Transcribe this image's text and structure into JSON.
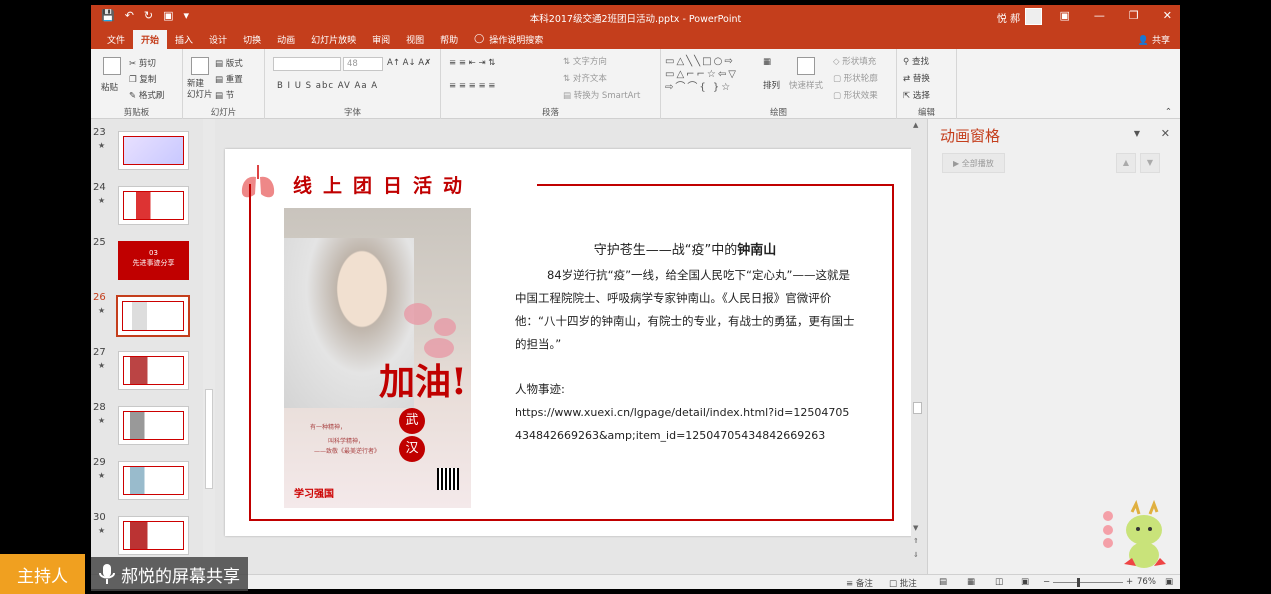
{
  "window": {
    "title": "本科2017级交通2班团日活动.pptx - PowerPoint",
    "user": "悦 郝"
  },
  "ribbon_tabs": [
    "文件",
    "开始",
    "插入",
    "设计",
    "切换",
    "动画",
    "幻灯片放映",
    "审阅",
    "视图",
    "帮助"
  ],
  "tell_me": "操作说明搜索",
  "share": "共享",
  "ribbon": {
    "clipboard": {
      "paste": "粘贴",
      "cut": "剪切",
      "copy": "复制",
      "format_painter": "格式刷",
      "label": "剪贴板"
    },
    "slides": {
      "new_slide": "新建\n幻灯片",
      "layout": "版式",
      "reset": "重置",
      "section": "节",
      "label": "幻灯片"
    },
    "font": {
      "size": "48",
      "label": "字体",
      "buttons": "B  I  U  S  abc  AV  Aa  A"
    },
    "paragraph": {
      "text_direction": "文字方向",
      "align_text": "对齐文本",
      "smartart": "转换为 SmartArt",
      "label": "段落"
    },
    "drawing": {
      "arrange": "排列",
      "quick_styles": "快速样式",
      "fill": "形状填充",
      "outline": "形状轮廓",
      "effects": "形状效果",
      "label": "绘图"
    },
    "editing": {
      "find": "查找",
      "replace": "替换",
      "select": "选择",
      "label": "编辑"
    }
  },
  "thumbnails": [
    {
      "num": "23",
      "selected": false,
      "caption": ""
    },
    {
      "num": "24",
      "selected": false,
      "caption": ""
    },
    {
      "num": "25",
      "selected": false,
      "caption": "03\n先进事迹分享"
    },
    {
      "num": "26",
      "selected": true,
      "caption": ""
    },
    {
      "num": "27",
      "selected": false,
      "caption": ""
    },
    {
      "num": "28",
      "selected": false,
      "caption": ""
    },
    {
      "num": "29",
      "selected": false,
      "caption": ""
    },
    {
      "num": "30",
      "selected": false,
      "caption": ""
    }
  ],
  "slide": {
    "title": "线上团日活动",
    "poster": {
      "headline": "加油!",
      "circle1": "武",
      "circle2": "汉",
      "caption1": "有一种精神，",
      "caption2": "叫科学精神，",
      "caption3": "——致敬《最美逆行者》",
      "logo": "学习强国"
    },
    "heading_prefix": "守护苍生——战“疫”中的",
    "heading_bold": "钟南山",
    "paragraph": "84岁逆行抗“疫”一线，给全国人民吃下“定心丸”——这就是中国工程院院士、呼吸病学专家钟南山。《人民日报》官微评价他：“八十四岁的钟南山，有院士的专业，有战士的勇猛，更有国士的担当。”",
    "deeds_label": "人物事迹:",
    "url": "https://www.xuexi.cn/lgpage/detail/index.html?id=12504705434842669263&amp;item_id=12504705434842669263"
  },
  "animation_pane": {
    "title": "动画窗格",
    "play_all": "全部播放"
  },
  "statusbar": {
    "notes": "备注",
    "comments": "批注",
    "zoom": "76%"
  },
  "overlay": {
    "host": "主持人",
    "sharing": "郝悦的屏幕共享"
  },
  "colors": {
    "accent": "#c43e1c",
    "slide_red": "#c00000",
    "host_badge": "#f0a020"
  }
}
